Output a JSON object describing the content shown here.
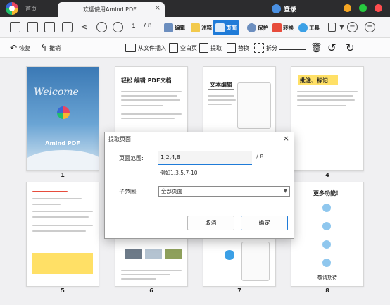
{
  "titlebar": {
    "home_tab": "首页",
    "doc_tab": "欢迎使用Amind PDF",
    "close_glyph": "×",
    "login": "登录"
  },
  "toolbar": {
    "current_page": "1",
    "page_separator": "/",
    "total_pages": "8",
    "modes": [
      "编辑",
      "注释",
      "页面",
      "保护",
      "转换",
      "工具"
    ],
    "active_mode": "页面",
    "zoom_minus": "−",
    "zoom_plus": "+"
  },
  "page_tools": {
    "restore": "恢复",
    "undo": "撤销",
    "from_file_insert": "从文件插入",
    "blank_page": "空白页",
    "extract": "提取",
    "replace": "替换",
    "split": "拆分"
  },
  "thumbnails": {
    "cover_script": "Welcome",
    "cover_title": "Amind PDF",
    "p2_heading": "轻松 编辑 PDF文档",
    "p3_heading": "文本编辑",
    "p4_heading": "批注、标记",
    "p8_heading": "更多功能！",
    "p8_footer": "敬请期待"
  },
  "page_numbers": [
    "1",
    "4",
    "5",
    "6",
    "7",
    "8"
  ],
  "dialog": {
    "title": "提取页面",
    "close_glyph": "×",
    "range_label": "页面范围:",
    "range_value": "1,2,4,8",
    "range_total": "/ 8",
    "range_example": "例如1,3,5,7-10",
    "subrange_label": "子范围:",
    "subrange_value": "全部页面",
    "cancel": "取消",
    "confirm": "确定"
  },
  "colors": {
    "accent": "#1f7bd8",
    "titlebar": "#2c2c2e"
  }
}
